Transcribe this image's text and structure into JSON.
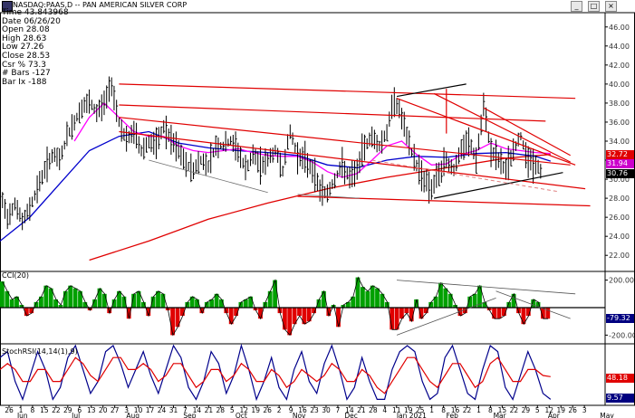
{
  "window": {
    "title": "NASDAQ:PAAS,D -- PAN AMERICAN SILVER CORP",
    "buttons": [
      "_",
      "□",
      "×"
    ]
  },
  "info_panel": [
    "Time  43.843968",
    "Date  06/26/20",
    "Open  28.08",
    "High  28.63",
    "Low   27.26",
    "Close 28.53",
    "Csr % 73.3",
    "# Bars -127",
    "Bar Ix -188"
  ],
  "colors": {
    "price_bars": "#000000",
    "ma_short": "#ff00ff",
    "ma_mid": "#0000cc",
    "ma_long": "#e00000",
    "trend_red": "#e00000",
    "trend_black": "#000000",
    "trend_gray": "#707070",
    "cci_pos": "#00a000",
    "cci_neg": "#e00000",
    "stoch_k": "#00008b",
    "stoch_d": "#e00000"
  },
  "tags": {
    "price_red": "32.72",
    "price_blue": "31.94",
    "price_black": "30.76",
    "cci": "-79.32",
    "stoch_red": "48.18",
    "stoch_blue": "9.57"
  },
  "chart_data": [
    {
      "type": "line",
      "panel": "price",
      "yticks": [
        "46.00",
        "44.00",
        "42.00",
        "40.00",
        "38.00",
        "36.00",
        "34.00",
        "32.00",
        "30.00",
        "28.00",
        "26.00",
        "24.00",
        "22.00"
      ],
      "ylim": [
        20.5,
        47.5
      ],
      "x_months": [
        {
          "label": "Jun",
          "day": 4
        },
        {
          "label": "Jul",
          "day": 26
        },
        {
          "label": "Aug",
          "day": 48
        },
        {
          "label": "Sep",
          "day": 71
        },
        {
          "label": "Oct",
          "day": 92
        },
        {
          "label": "Nov",
          "day": 115
        },
        {
          "label": "Dec",
          "day": 136
        },
        {
          "label": "Jan 2021",
          "day": 157
        },
        {
          "label": "Feb",
          "day": 177
        },
        {
          "label": "Mar",
          "day": 196
        },
        {
          "label": "Apr",
          "day": 218
        },
        {
          "label": "May",
          "day": 239
        }
      ],
      "x_ticks": [
        "26",
        "1",
        "8",
        "15",
        "22",
        "29",
        "6",
        "13",
        "20",
        "27",
        "3",
        "10",
        "17",
        "24",
        "31",
        "7",
        "14",
        "21",
        "28",
        "5",
        "12",
        "19",
        "26",
        "2",
        "9",
        "16",
        "23",
        "30",
        "7",
        "14",
        "21",
        "28",
        "4",
        "11",
        "19",
        "25",
        "1",
        "8",
        "16",
        "22",
        "1",
        "8",
        "15",
        "22",
        "29",
        "5",
        "12",
        "19",
        "26",
        "3"
      ],
      "price_path": [
        [
          0,
          28.5
        ],
        [
          3,
          26
        ],
        [
          6,
          27.5
        ],
        [
          9,
          25.5
        ],
        [
          12,
          27
        ],
        [
          15,
          29
        ],
        [
          18,
          31
        ],
        [
          21,
          32.5
        ],
        [
          24,
          32
        ],
        [
          27,
          34.5
        ],
        [
          30,
          36
        ],
        [
          33,
          37.5
        ],
        [
          36,
          38
        ],
        [
          39,
          37
        ],
        [
          42,
          38
        ],
        [
          45,
          40
        ],
        [
          48,
          36
        ],
        [
          51,
          34
        ],
        [
          54,
          35
        ],
        [
          57,
          33
        ],
        [
          60,
          34
        ],
        [
          63,
          33.5
        ],
        [
          66,
          35.5
        ],
        [
          69,
          34
        ],
        [
          72,
          33
        ],
        [
          75,
          31.5
        ],
        [
          78,
          31
        ],
        [
          81,
          32
        ],
        [
          84,
          31.5
        ],
        [
          87,
          33.5
        ],
        [
          90,
          33.5
        ],
        [
          93,
          34
        ],
        [
          96,
          33
        ],
        [
          99,
          31
        ],
        [
          102,
          32.5
        ],
        [
          105,
          31.5
        ],
        [
          108,
          32
        ],
        [
          111,
          33
        ],
        [
          114,
          31
        ],
        [
          117,
          35
        ],
        [
          120,
          32.5
        ],
        [
          123,
          32
        ],
        [
          126,
          31
        ],
        [
          129,
          29
        ],
        [
          132,
          28.5
        ],
        [
          135,
          30
        ],
        [
          138,
          31.5
        ],
        [
          141,
          30
        ],
        [
          144,
          31
        ],
        [
          147,
          33.5
        ],
        [
          150,
          34.5
        ],
        [
          153,
          33.5
        ],
        [
          156,
          35
        ],
        [
          159,
          38.5
        ],
        [
          162,
          36.5
        ],
        [
          165,
          33.5
        ],
        [
          168,
          31.5
        ],
        [
          171,
          30
        ],
        [
          174,
          29
        ],
        [
          177,
          30.5
        ],
        [
          180,
          32
        ],
        [
          183,
          31
        ],
        [
          186,
          33
        ],
        [
          189,
          34
        ],
        [
          192,
          32
        ],
        [
          195,
          37.5
        ],
        [
          198,
          33
        ],
        [
          201,
          32
        ],
        [
          204,
          31
        ],
        [
          207,
          33
        ],
        [
          210,
          34.5
        ],
        [
          213,
          32
        ],
        [
          216,
          31.5
        ],
        [
          219,
          30.5
        ]
      ],
      "ma_short": [
        [
          30,
          34
        ],
        [
          36,
          36.5
        ],
        [
          42,
          38
        ],
        [
          48,
          36.5
        ],
        [
          54,
          35
        ],
        [
          60,
          34.5
        ],
        [
          66,
          34.5
        ],
        [
          72,
          33.5
        ],
        [
          78,
          33
        ],
        [
          84,
          32.8
        ],
        [
          90,
          33
        ],
        [
          96,
          33.2
        ],
        [
          102,
          32.8
        ],
        [
          108,
          32.5
        ],
        [
          114,
          32.4
        ],
        [
          120,
          32.4
        ],
        [
          126,
          31.8
        ],
        [
          132,
          30.8
        ],
        [
          138,
          30.2
        ],
        [
          144,
          30.6
        ],
        [
          150,
          32
        ],
        [
          156,
          33.5
        ],
        [
          162,
          34
        ],
        [
          168,
          32.6
        ],
        [
          174,
          31.5
        ],
        [
          180,
          31.6
        ],
        [
          186,
          32.6
        ],
        [
          192,
          33
        ],
        [
          198,
          33.8
        ],
        [
          204,
          33.2
        ],
        [
          210,
          33
        ],
        [
          216,
          32.8
        ],
        [
          222,
          32.7
        ]
      ],
      "ma_mid": [
        [
          0,
          23.5
        ],
        [
          12,
          26
        ],
        [
          24,
          29.5
        ],
        [
          36,
          33
        ],
        [
          48,
          34.5
        ],
        [
          60,
          35
        ],
        [
          72,
          33.8
        ],
        [
          84,
          33.3
        ],
        [
          96,
          33
        ],
        [
          108,
          32.8
        ],
        [
          120,
          32.5
        ],
        [
          132,
          31.5
        ],
        [
          144,
          31.2
        ],
        [
          156,
          32
        ],
        [
          168,
          32.4
        ],
        [
          180,
          32.3
        ],
        [
          192,
          32.7
        ],
        [
          204,
          32.8
        ],
        [
          216,
          32.4
        ],
        [
          222,
          31.9
        ]
      ],
      "ma_long": [
        [
          36,
          21.5
        ],
        [
          60,
          23.5
        ],
        [
          84,
          25.8
        ],
        [
          108,
          27.5
        ],
        [
          132,
          29
        ],
        [
          156,
          30.2
        ],
        [
          180,
          31.2
        ],
        [
          204,
          32.2
        ],
        [
          222,
          32.6
        ]
      ]
    },
    {
      "type": "area",
      "panel": "CCI(20)",
      "yticks": [
        "200.00",
        "-200.00"
      ],
      "ylim": [
        -250,
        250
      ],
      "values": [
        190,
        120,
        60,
        80,
        20,
        -60,
        -40,
        40,
        80,
        160,
        140,
        60,
        20,
        120,
        160,
        140,
        120,
        40,
        -20,
        60,
        140,
        100,
        -40,
        60,
        120,
        80,
        -80,
        100,
        120,
        40,
        -60,
        80,
        120,
        100,
        -20,
        -200,
        -140,
        -60,
        40,
        80,
        60,
        -40,
        40,
        60,
        100,
        60,
        -40,
        -120,
        -60,
        40,
        60,
        80,
        -20,
        -80,
        40,
        120,
        200,
        -40,
        -160,
        -200,
        -120,
        -60,
        -120,
        -100,
        -40,
        60,
        120,
        -60,
        20,
        -140,
        20,
        40,
        80,
        220,
        150,
        120,
        160,
        140,
        100,
        40,
        -160,
        -160,
        -80,
        -40,
        -100,
        60,
        -80,
        -40,
        40,
        80,
        180,
        140,
        100,
        20,
        -60,
        -40,
        80,
        100,
        160,
        40,
        -20,
        -80,
        -80,
        -60,
        40,
        100,
        -40,
        -120,
        -60,
        60,
        40,
        -80,
        -80
      ]
    },
    {
      "type": "line",
      "panel": "StochRSI(14,14(1),9)",
      "ylim": [
        0,
        100
      ],
      "series": [
        {
          "values": [
            80,
            90,
            40,
            10,
            50,
            90,
            60,
            10,
            30,
            80,
            100,
            60,
            20,
            40,
            90,
            100,
            70,
            30,
            60,
            90,
            50,
            20,
            60,
            100,
            80,
            30,
            10,
            40,
            90,
            70,
            20,
            50,
            100,
            60,
            10,
            40,
            80,
            30,
            10,
            60,
            90,
            40,
            20,
            70,
            100,
            60,
            10,
            30,
            80,
            40,
            10,
            10,
            60,
            90,
            100,
            90,
            40,
            10,
            20,
            80,
            100,
            60,
            20,
            10,
            60,
            100,
            90,
            30,
            10,
            50,
            90,
            60,
            20,
            10
          ]
        },
        {
          "values": [
            60,
            70,
            60,
            40,
            40,
            60,
            60,
            40,
            40,
            60,
            80,
            70,
            50,
            40,
            60,
            80,
            80,
            60,
            60,
            70,
            60,
            40,
            50,
            70,
            70,
            50,
            30,
            40,
            60,
            60,
            40,
            50,
            70,
            60,
            40,
            40,
            60,
            50,
            30,
            40,
            60,
            50,
            40,
            50,
            70,
            60,
            40,
            40,
            60,
            50,
            30,
            20,
            40,
            60,
            80,
            80,
            60,
            40,
            30,
            50,
            70,
            70,
            50,
            30,
            40,
            70,
            80,
            60,
            40,
            40,
            60,
            60,
            50,
            48
          ]
        }
      ]
    }
  ]
}
